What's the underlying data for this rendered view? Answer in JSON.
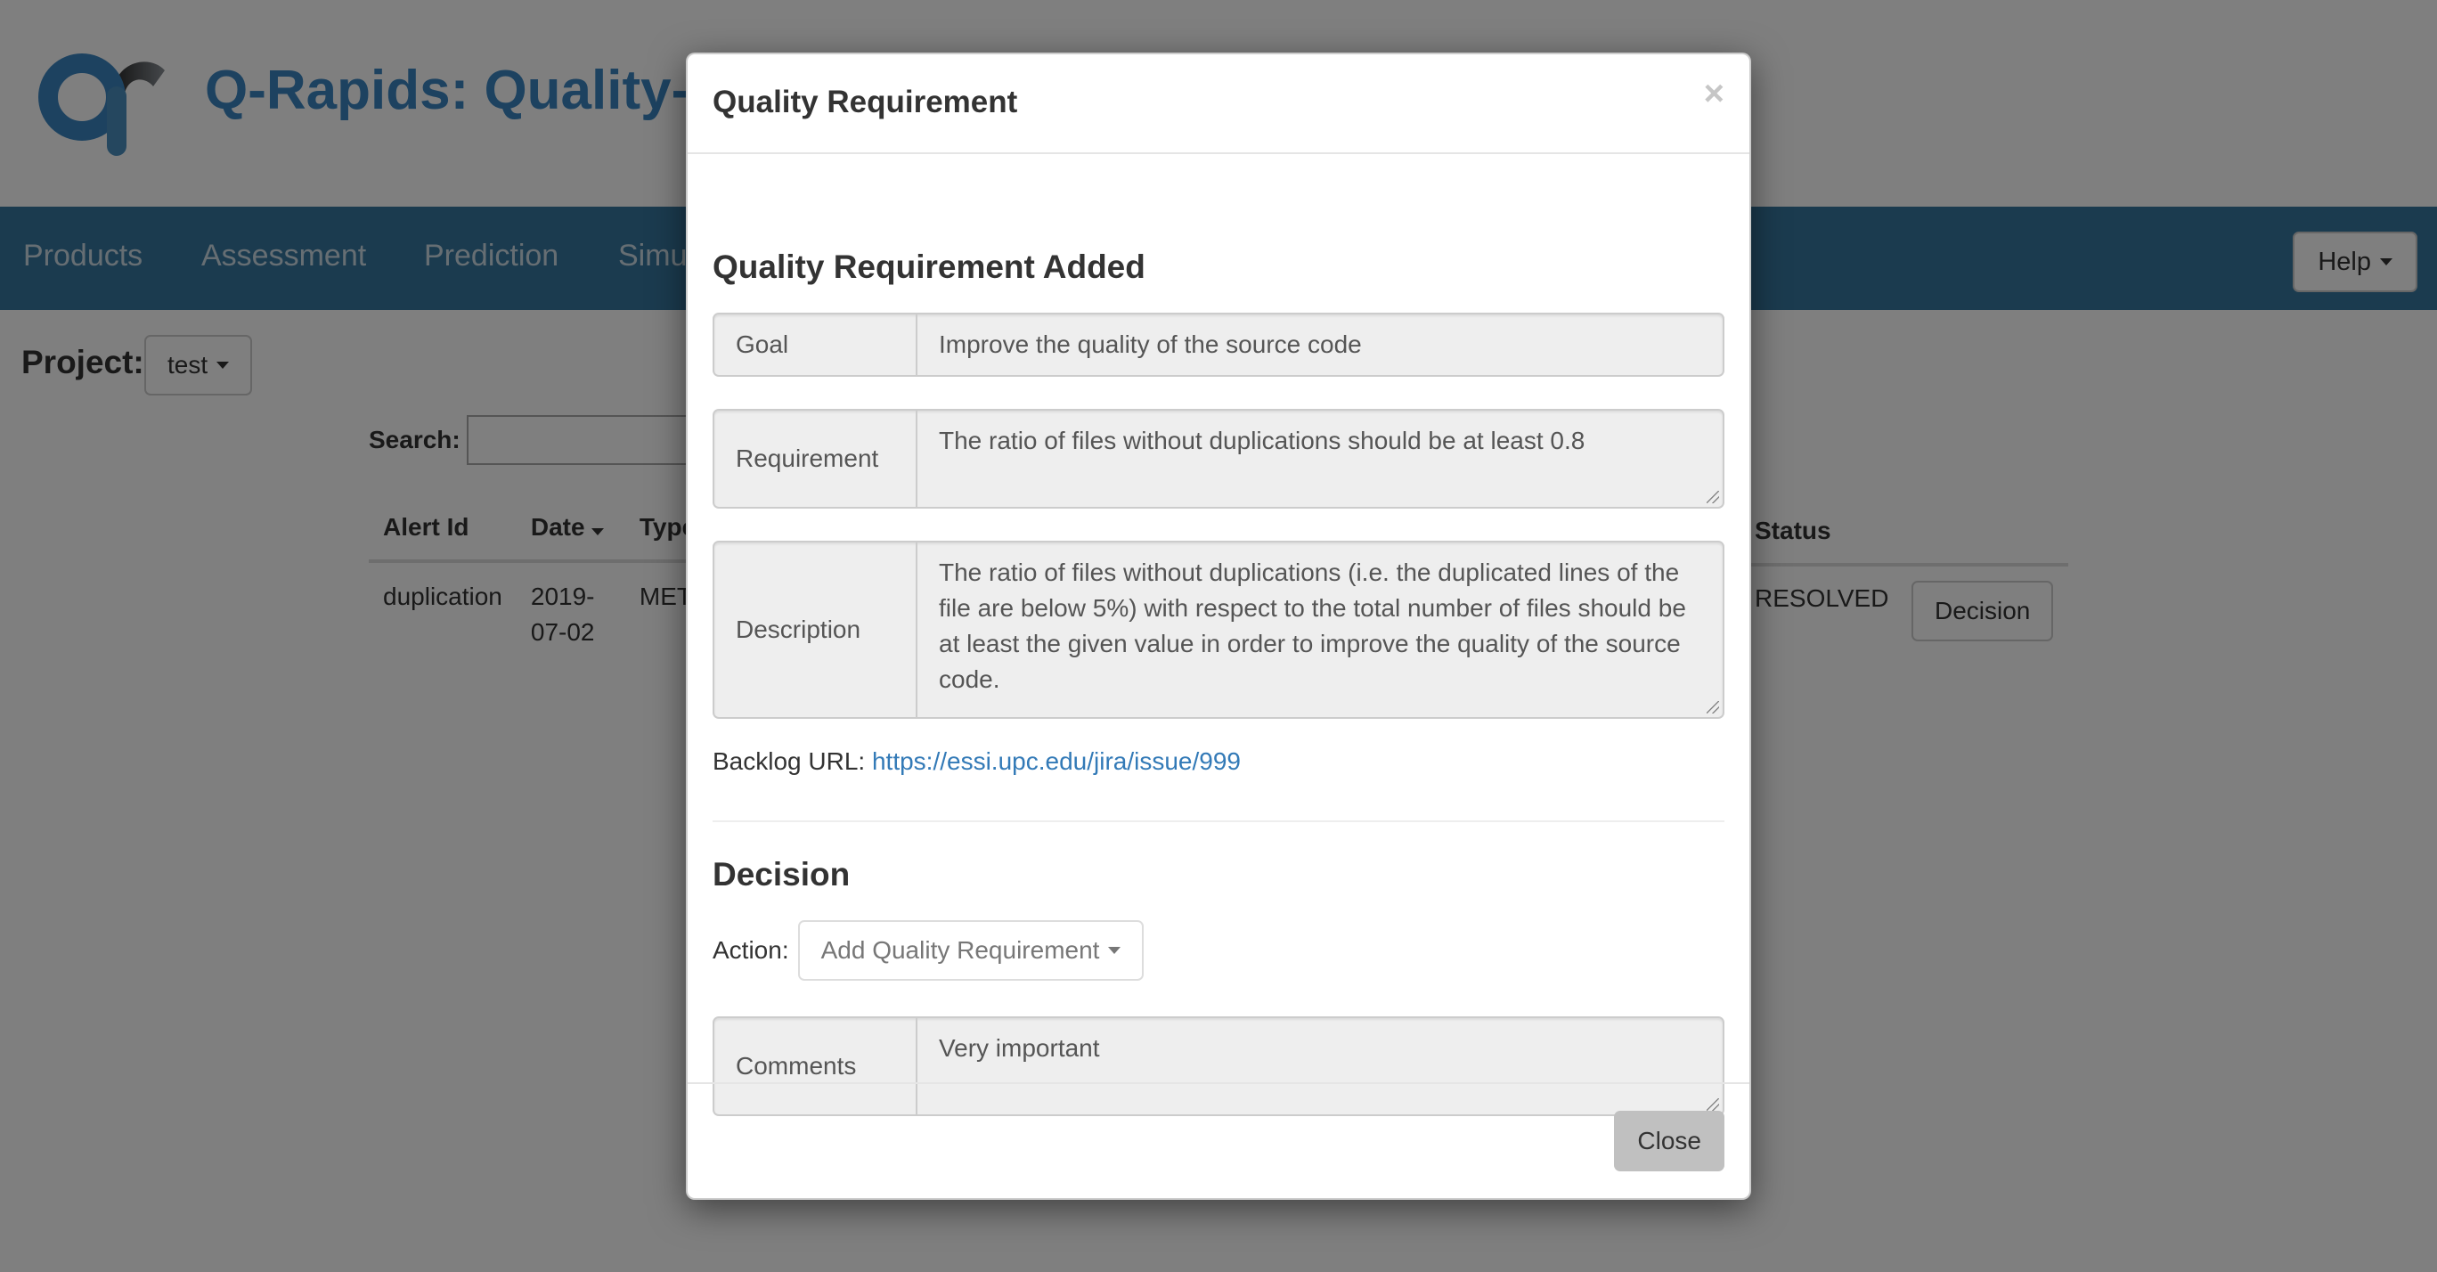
{
  "app": {
    "title": "Q-Rapids: Quality-aware Rapid Software Development"
  },
  "navbar": {
    "items": [
      {
        "label": "Products"
      },
      {
        "label": "Assessment"
      },
      {
        "label": "Prediction"
      },
      {
        "label": "Simulation"
      }
    ],
    "help_label": "Help"
  },
  "project": {
    "label": "Project:",
    "selected": "test"
  },
  "search": {
    "label": "Search:",
    "value": ""
  },
  "alerts_table": {
    "columns": [
      "Alert Id",
      "Date",
      "Type",
      "Status"
    ],
    "rows": [
      {
        "alert_id": "duplication",
        "date": "2019-07-02",
        "type": "METRIC",
        "status": "RESOLVED",
        "action_label": "Decision"
      }
    ]
  },
  "modal": {
    "title": "Quality Requirement",
    "close_icon": "×",
    "section_title": "Quality Requirement Added",
    "fields": {
      "goal": {
        "label": "Goal",
        "value": "Improve the quality of the source code"
      },
      "requirement": {
        "label": "Requirement",
        "value": "The ratio of files without duplications should be at least 0.8"
      },
      "description": {
        "label": "Description",
        "value": "The ratio of files without duplications (i.e. the duplicated lines of the file are below 5%) with respect to the total number of files should be at least the given value in order to improve the quality of the source code."
      }
    },
    "backlog": {
      "label": "Backlog URL:",
      "url": "https://essi.upc.edu/jira/issue/999"
    },
    "decision": {
      "title": "Decision",
      "action_label": "Action:",
      "action_selected": "Add Quality Requirement",
      "comments_label": "Comments",
      "comments_value": "Very important"
    },
    "close_button": "Close"
  },
  "colors": {
    "navbar": "#36769f",
    "brand_title": "#3a85c0",
    "link": "#337ab7"
  }
}
